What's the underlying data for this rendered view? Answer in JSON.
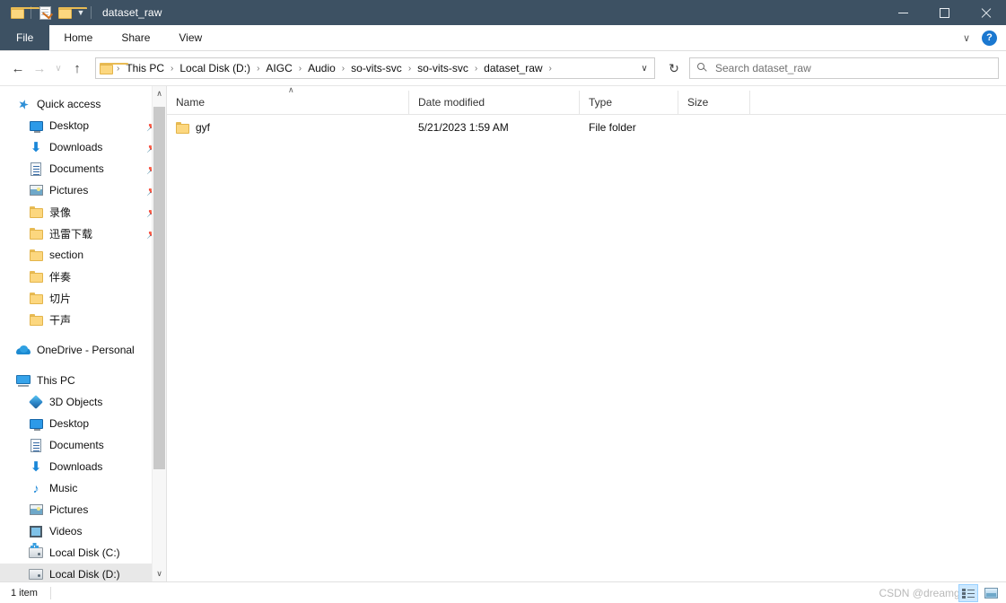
{
  "window": {
    "title": "dataset_raw",
    "quick_access_toolbar": [
      {
        "name": "folder-icon",
        "label": "Properties folder"
      },
      {
        "name": "properties-icon",
        "label": "Properties"
      },
      {
        "name": "new-folder-icon",
        "label": "New folder"
      },
      {
        "name": "customize-caret-icon",
        "label": "Customize Quick Access Toolbar"
      }
    ],
    "controls": {
      "minimize": "Minimize",
      "maximize": "Maximize",
      "close": "Close"
    }
  },
  "ribbon": {
    "tabs": [
      {
        "label": "File"
      },
      {
        "label": "Home"
      },
      {
        "label": "Share"
      },
      {
        "label": "View"
      }
    ],
    "expand_label": "∨",
    "help_label": "?"
  },
  "address_bar": {
    "back_label": "←",
    "forward_label": "→",
    "recent_label": "∨",
    "up_label": "↑",
    "crumbs": [
      {
        "label": "This PC"
      },
      {
        "label": "Local Disk (D:)"
      },
      {
        "label": "AIGC"
      },
      {
        "label": "Audio"
      },
      {
        "label": "so-vits-svc"
      },
      {
        "label": "so-vits-svc"
      },
      {
        "label": "dataset_raw"
      }
    ],
    "separator": "›",
    "history_label": "∨",
    "refresh_label": "↻",
    "highlight_color": "#c00000"
  },
  "search": {
    "placeholder": "Search dataset_raw",
    "value": ""
  },
  "navigation_pane": {
    "sections": [
      {
        "root": {
          "label": "Quick access",
          "icon": "star-icon"
        },
        "items": [
          {
            "label": "Desktop",
            "icon": "monitor-icon",
            "pinned": true
          },
          {
            "label": "Downloads",
            "icon": "download-icon",
            "pinned": true
          },
          {
            "label": "Documents",
            "icon": "document-icon",
            "pinned": true
          },
          {
            "label": "Pictures",
            "icon": "pictures-icon",
            "pinned": true
          },
          {
            "label": "录像",
            "icon": "folder-icon",
            "pinned": true
          },
          {
            "label": "迅雷下载",
            "icon": "folder-icon",
            "pinned": true
          },
          {
            "label": "section",
            "icon": "folder-icon",
            "pinned": false
          },
          {
            "label": "伴奏",
            "icon": "folder-icon",
            "pinned": false
          },
          {
            "label": "切片",
            "icon": "folder-icon",
            "pinned": false
          },
          {
            "label": "干声",
            "icon": "folder-icon",
            "pinned": false
          }
        ]
      },
      {
        "root": {
          "label": "OneDrive - Personal",
          "icon": "cloud-icon"
        },
        "items": []
      },
      {
        "root": {
          "label": "This PC",
          "icon": "this-pc-icon"
        },
        "items": [
          {
            "label": "3D Objects",
            "icon": "3d-objects-icon",
            "pinned": false
          },
          {
            "label": "Desktop",
            "icon": "monitor-icon",
            "pinned": false
          },
          {
            "label": "Documents",
            "icon": "document-icon",
            "pinned": false
          },
          {
            "label": "Downloads",
            "icon": "download-icon",
            "pinned": false
          },
          {
            "label": "Music",
            "icon": "music-icon",
            "pinned": false
          },
          {
            "label": "Pictures",
            "icon": "pictures-icon",
            "pinned": false
          },
          {
            "label": "Videos",
            "icon": "video-icon",
            "pinned": false
          },
          {
            "label": "Local Disk (C:)",
            "icon": "system-disk-icon",
            "pinned": false
          },
          {
            "label": "Local Disk (D:)",
            "icon": "disk-icon",
            "pinned": false,
            "selected": true
          }
        ]
      }
    ],
    "scrollbar": {
      "up_arrow": "∧",
      "down_arrow": "∨"
    }
  },
  "file_list": {
    "columns": [
      {
        "label": "Name",
        "key": "name"
      },
      {
        "label": "Date modified",
        "key": "date"
      },
      {
        "label": "Type",
        "key": "type"
      },
      {
        "label": "Size",
        "key": "size"
      }
    ],
    "sort_indicator": "∧",
    "rows": [
      {
        "name": "gyf",
        "date": "5/21/2023 1:59 AM",
        "type": "File folder",
        "size": "",
        "icon": "folder-icon"
      }
    ]
  },
  "status_bar": {
    "item_count": "1 item",
    "view_buttons": [
      {
        "name": "details-view-button",
        "label": "Details view",
        "active": true
      },
      {
        "name": "large-icons-view-button",
        "label": "Large icons view",
        "active": false
      }
    ]
  },
  "watermark": {
    "text": "CSDN @dreamgyf"
  }
}
